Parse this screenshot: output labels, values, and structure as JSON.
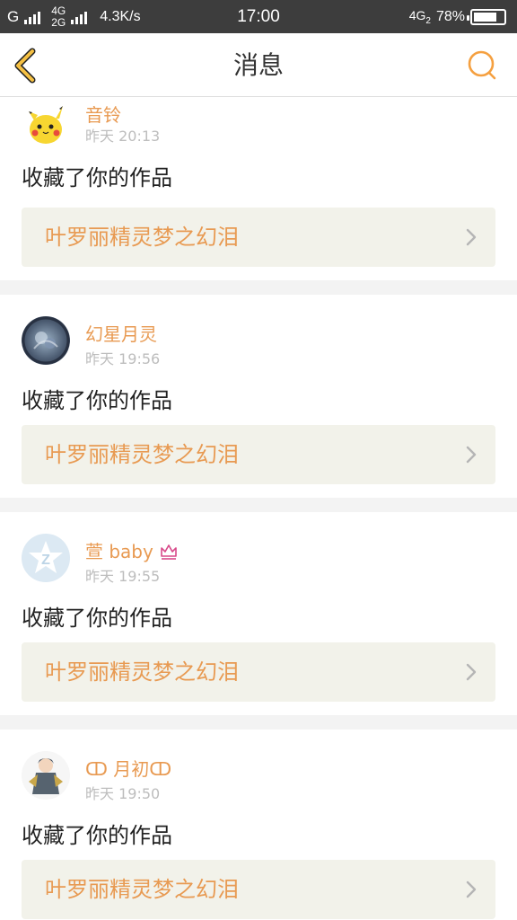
{
  "status_bar": {
    "carrier": "G",
    "net_top": "4G",
    "net_bottom": "2G",
    "speed": "4.3K/s",
    "time": "17:00",
    "net_right": "4G",
    "net_right_sub": "2",
    "battery_pct": "78%",
    "battery_level": 0.78
  },
  "header": {
    "title": "消息",
    "back_icon": "chevron-left-icon",
    "search_icon": "search-icon",
    "accent": "#f5a040"
  },
  "messages": [
    {
      "user": "音铃",
      "time": "昨天 20:13",
      "action": "收藏了你的作品",
      "work": "叶罗丽精灵梦之幻泪",
      "avatar": "pikachu-avatar"
    },
    {
      "user": "幻星月灵",
      "time": "昨天 19:56",
      "action": "收藏了你的作品",
      "work": "叶罗丽精灵梦之幻泪",
      "avatar": "anime-avatar"
    },
    {
      "user": "萱 baby",
      "time": "昨天 19:55",
      "action": "收藏了你的作品",
      "work": "叶罗丽精灵梦之幻泪",
      "avatar": "qzone-default-avatar"
    },
    {
      "user": "ↀ 月初ↀ",
      "time": "昨天 19:50",
      "action": "收藏了你的作品",
      "work": "叶罗丽精灵梦之幻泪",
      "avatar": "anime-boy-avatar"
    }
  ],
  "colors": {
    "username": "#e89a52",
    "work_title": "#e89a52",
    "link_bg": "#f2f2ea",
    "divider": "#f3f3f3"
  }
}
